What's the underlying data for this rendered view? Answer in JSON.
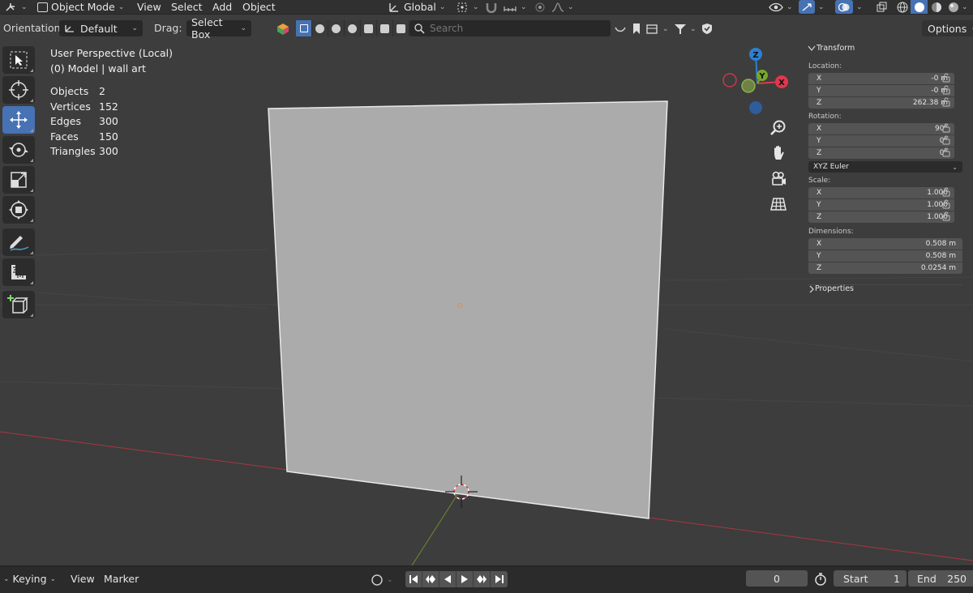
{
  "header": {
    "mode": "Object Mode",
    "menu": [
      "View",
      "Select",
      "Add",
      "Object"
    ],
    "transform_orientation": "Global"
  },
  "tool_settings": {
    "orientation_label": "Orientation:",
    "orientation_value": "Default",
    "drag_label": "Drag:",
    "drag_value": "Select Box",
    "search_placeholder": "Search",
    "options_label": "Options"
  },
  "viewport": {
    "perspective": "User Perspective (Local)",
    "context": "(0) Model | wall art",
    "stats": [
      {
        "label": "Objects",
        "value": "2"
      },
      {
        "label": "Vertices",
        "value": "152"
      },
      {
        "label": "Edges",
        "value": "300"
      },
      {
        "label": "Faces",
        "value": "150"
      },
      {
        "label": "Triangles",
        "value": "300"
      }
    ],
    "gizmo_axes": {
      "x": "X",
      "y": "Y",
      "z": "Z"
    }
  },
  "transform_panel": {
    "title": "Transform",
    "location_label": "Location:",
    "location": [
      {
        "axis": "X",
        "value": "-0 m"
      },
      {
        "axis": "Y",
        "value": "-0 m"
      },
      {
        "axis": "Z",
        "value": "262.38 m"
      }
    ],
    "rotation_label": "Rotation:",
    "rotation": [
      {
        "axis": "X",
        "value": "90°"
      },
      {
        "axis": "Y",
        "value": "0°"
      },
      {
        "axis": "Z",
        "value": "0°"
      }
    ],
    "rotation_mode": "XYZ Euler",
    "scale_label": "Scale:",
    "scale": [
      {
        "axis": "X",
        "value": "1.000"
      },
      {
        "axis": "Y",
        "value": "1.000"
      },
      {
        "axis": "Z",
        "value": "1.000"
      }
    ],
    "dimensions_label": "Dimensions:",
    "dimensions": [
      {
        "axis": "X",
        "value": "0.508 m"
      },
      {
        "axis": "Y",
        "value": "0.508 m"
      },
      {
        "axis": "Z",
        "value": "0.0254 m"
      }
    ],
    "properties_label": "Properties"
  },
  "timeline": {
    "keying": "Keying",
    "view": "View",
    "marker": "Marker",
    "current_frame": "0",
    "start_label": "Start",
    "start_value": "1",
    "end_label": "End",
    "end_value": "250"
  },
  "colors": {
    "active_blue": "#4772b3",
    "axis_x": "#e0374d",
    "axis_y": "#78a62a",
    "axis_z": "#2d7fd1",
    "viewport_bg": "#3d3d3d"
  }
}
